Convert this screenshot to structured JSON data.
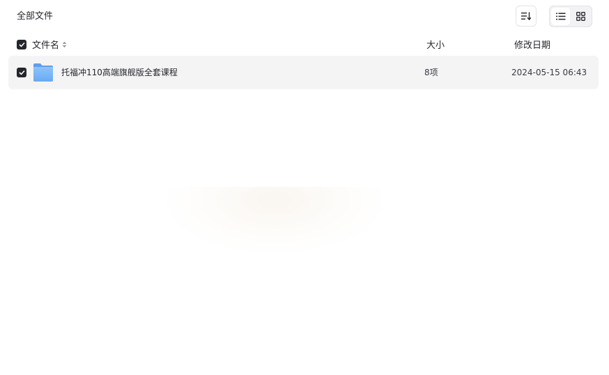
{
  "header": {
    "breadcrumb": "全部文件",
    "sort_icon": "sort-descending-icon",
    "view_modes": [
      {
        "name": "list",
        "icon": "list-view-icon",
        "active": true
      },
      {
        "name": "grid",
        "icon": "grid-view-icon",
        "active": false
      }
    ]
  },
  "columns": {
    "name": "文件名",
    "size": "大小",
    "date": "修改日期"
  },
  "files": [
    {
      "name": "托福冲110高端旗舰版全套课程",
      "size": "8项",
      "date": "2024-05-15 06:43",
      "type": "folder",
      "checked": true
    }
  ],
  "colors": {
    "accent": "#25262b",
    "row_bg": "#f4f4f5",
    "folder": "#7cb8f7"
  }
}
